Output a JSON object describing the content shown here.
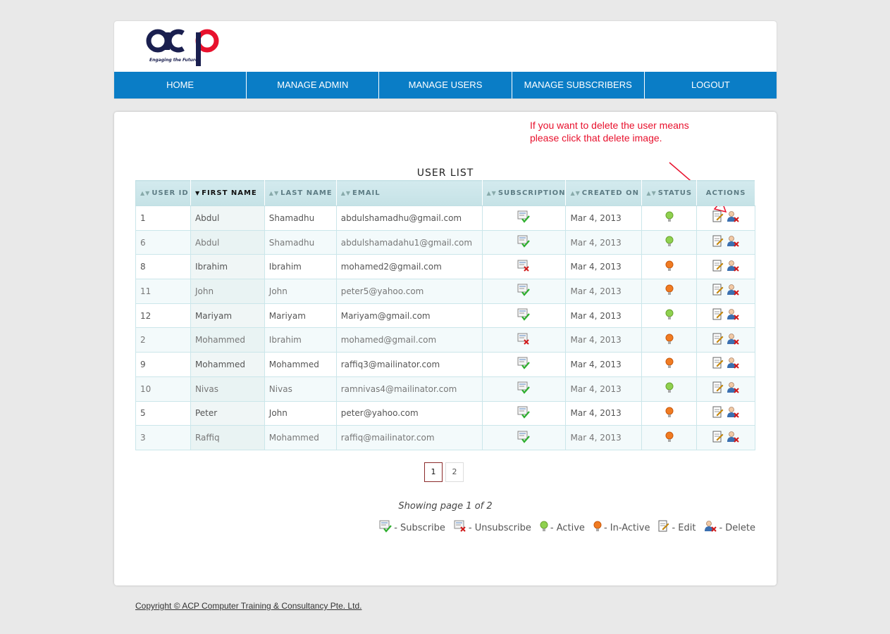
{
  "brand": {
    "logo_text": "acp",
    "tagline": "Engaging the Future",
    "colors": {
      "dark": "#1a1f4f",
      "red": "#e8112d",
      "nav": "#0a7dc6"
    }
  },
  "nav": {
    "items": [
      {
        "label": "HOME"
      },
      {
        "label": "MANAGE ADMIN"
      },
      {
        "label": "MANAGE USERS"
      },
      {
        "label": "MANAGE SUBSCRIBERS"
      },
      {
        "label": "LOGOUT"
      }
    ]
  },
  "annotation": {
    "text": "If you want to delete the user means please click that delete image."
  },
  "user_list": {
    "title": "USER LIST",
    "columns": [
      "USER ID",
      "FIRST NAME",
      "LAST NAME",
      "EMAIL",
      "SUBSCRIPTION",
      "CREATED ON",
      "STATUS",
      "ACTIONS"
    ],
    "rows": [
      {
        "id": "1",
        "first": "Abdul",
        "last": "Shamadhu",
        "email": "abdulshamadhu@gmail.com",
        "subscribed": true,
        "created": "Mar 4, 2013",
        "active": true
      },
      {
        "id": "6",
        "first": "Abdul",
        "last": "Shamadhu",
        "email": "abdulshamadahu1@gmail.com",
        "subscribed": true,
        "created": "Mar 4, 2013",
        "active": true
      },
      {
        "id": "8",
        "first": "Ibrahim",
        "last": "Ibrahim",
        "email": "mohamed2@gmail.com",
        "subscribed": false,
        "created": "Mar 4, 2013",
        "active": false
      },
      {
        "id": "11",
        "first": "John",
        "last": "John",
        "email": "peter5@yahoo.com",
        "subscribed": true,
        "created": "Mar 4, 2013",
        "active": false
      },
      {
        "id": "12",
        "first": "Mariyam",
        "last": "Mariyam",
        "email": "Mariyam@gmail.com",
        "subscribed": true,
        "created": "Mar 4, 2013",
        "active": true
      },
      {
        "id": "2",
        "first": "Mohammed",
        "last": "Ibrahim",
        "email": "mohamed@gmail.com",
        "subscribed": false,
        "created": "Mar 4, 2013",
        "active": false
      },
      {
        "id": "9",
        "first": "Mohammed",
        "last": "Mohammed",
        "email": "raffiq3@mailinator.com",
        "subscribed": true,
        "created": "Mar 4, 2013",
        "active": false
      },
      {
        "id": "10",
        "first": "Nivas",
        "last": "Nivas",
        "email": "ramnivas4@mailinator.com",
        "subscribed": true,
        "created": "Mar 4, 2013",
        "active": true
      },
      {
        "id": "5",
        "first": "Peter",
        "last": "John",
        "email": "peter@yahoo.com",
        "subscribed": true,
        "created": "Mar 4, 2013",
        "active": false
      },
      {
        "id": "3",
        "first": "Raffiq",
        "last": "Mohammed",
        "email": "raffiq@mailinator.com",
        "subscribed": true,
        "created": "Mar 4, 2013",
        "active": false
      }
    ]
  },
  "pagination": {
    "pages": [
      "1",
      "2"
    ],
    "current": "1",
    "summary": "Showing page 1 of 2"
  },
  "legend": {
    "subscribe": "- Subscribe",
    "unsubscribe": "- Unsubscribe",
    "active": "- Active",
    "inactive": "- In-Active",
    "edit": "- Edit",
    "delete": "- Delete"
  },
  "icons": {
    "subscribe": "subscribe-icon",
    "unsubscribe": "unsubscribe-icon",
    "active": "active-bulb-icon",
    "inactive": "inactive-bulb-icon",
    "edit": "edit-icon",
    "delete": "delete-user-icon"
  },
  "footer": {
    "copyright": "Copyright © ACP Computer Training & Consultancy Pte. Ltd."
  }
}
